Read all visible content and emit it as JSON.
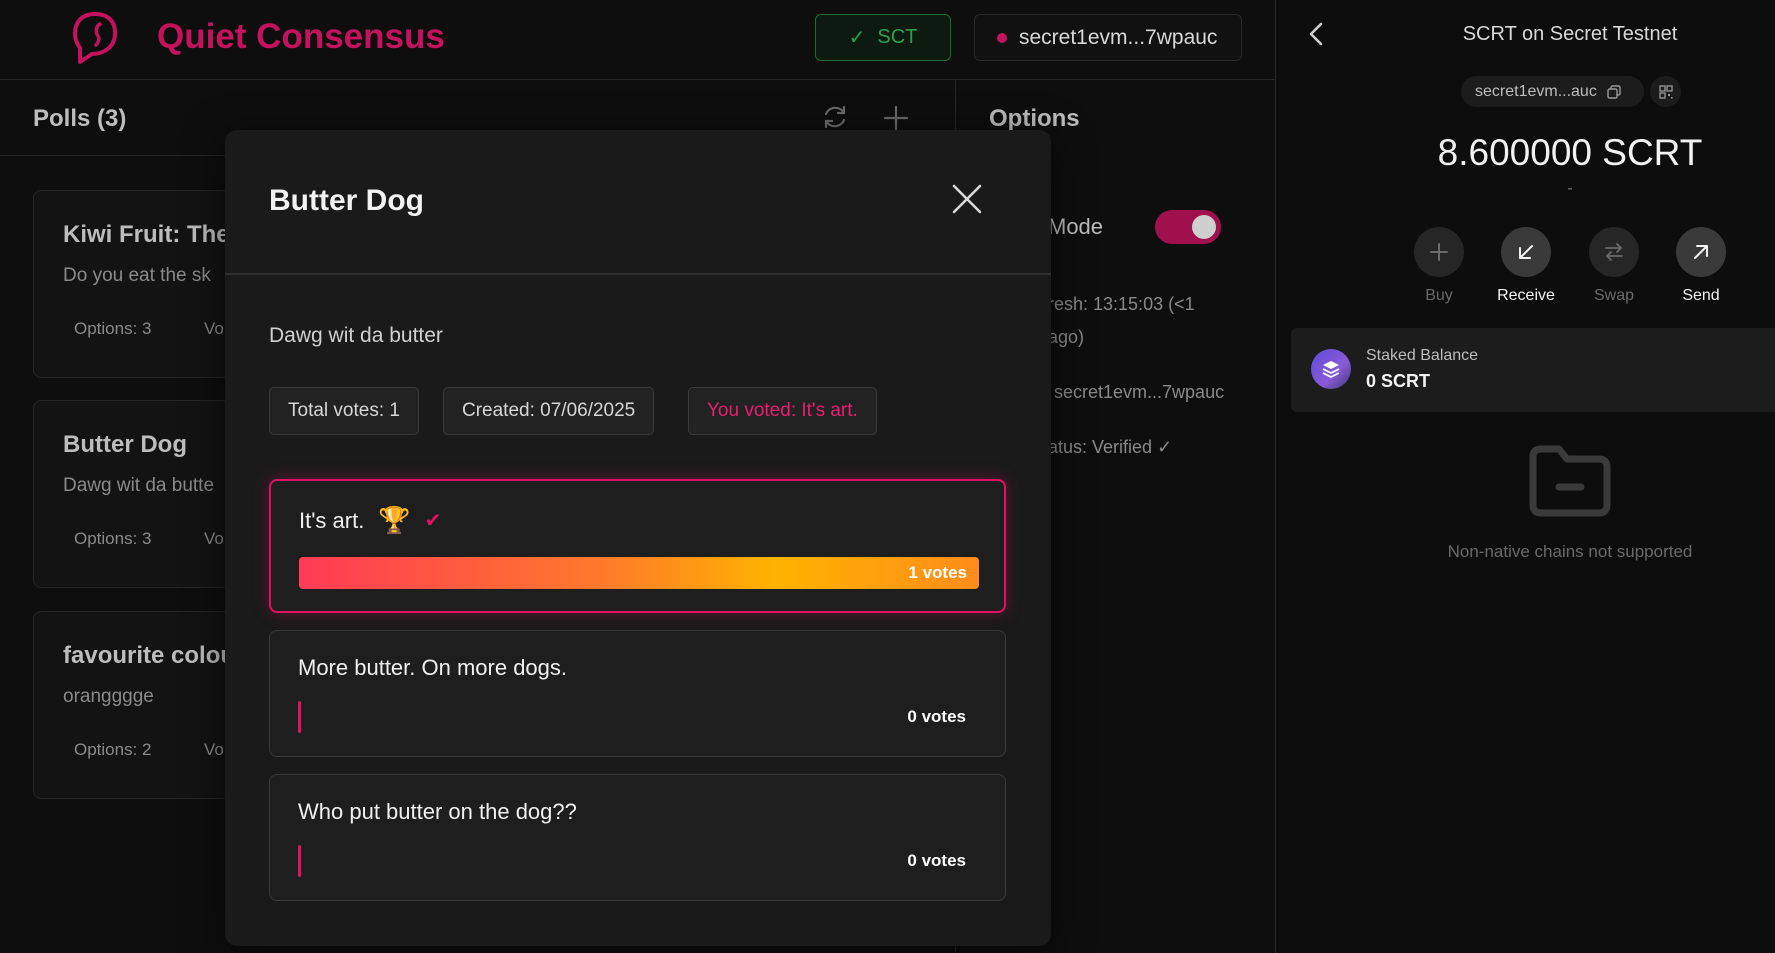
{
  "app": {
    "title": "Quiet Consensus",
    "network_label": "SCT",
    "wallet_short": "secret1evm...7wpauc"
  },
  "polls": {
    "header": "Polls (3)",
    "cards": [
      {
        "title": "Kiwi Fruit: The",
        "desc": "Do you eat the sk",
        "options": "Options: 3",
        "votes": "Vo"
      },
      {
        "title": "Butter Dog",
        "desc": "Dawg wit da butte",
        "options": "Options: 3",
        "votes": "Vo"
      },
      {
        "title": "favourite colou",
        "desc": "orangggge",
        "options": "Options: 2",
        "votes": "Vo"
      }
    ]
  },
  "options_panel": {
    "title": "Options",
    "mode_label": "Mode",
    "refresh_line1": "resh: 13:15:03 (<1",
    "refresh_line2": "ago)",
    "address": "secret1evm...7wpauc",
    "status": "atus: Verified ✓"
  },
  "modal": {
    "title": "Butter Dog",
    "description": "Dawg wit da butter",
    "chips": {
      "total_votes": "Total votes: 1",
      "created": "Created: 07/06/2025",
      "voted": "You voted: It's art."
    },
    "options": [
      {
        "label": "It's art.",
        "votes_text": "1 votes",
        "votes": 1,
        "winner": true,
        "trophy": "🏆",
        "check": "✔"
      },
      {
        "label": "More butter. On more dogs.",
        "votes_text": "0 votes",
        "votes": 0,
        "winner": false
      },
      {
        "label": "Who put butter on the dog??",
        "votes_text": "0 votes",
        "votes": 0,
        "winner": false
      }
    ]
  },
  "wallet": {
    "title": "SCRT on Secret Testnet",
    "address": "secret1evm...auc",
    "balance": "8.600000 SCRT",
    "fiat": "-",
    "actions": [
      {
        "label": "Buy",
        "active": false
      },
      {
        "label": "Receive",
        "active": true
      },
      {
        "label": "Swap",
        "active": false
      },
      {
        "label": "Send",
        "active": true
      }
    ],
    "staked_label": "Staked Balance",
    "staked_value": "0 SCRT",
    "nonnative_text": "Non-native chains not supported"
  },
  "colors": {
    "accent": "#c4125d",
    "network_green": "#2f9e4d"
  }
}
